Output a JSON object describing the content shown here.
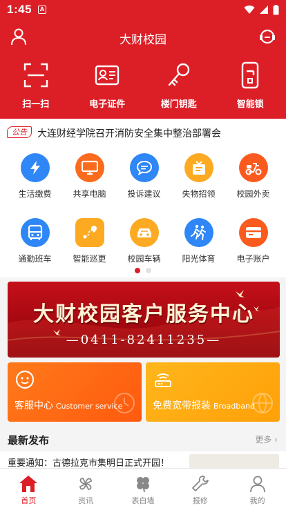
{
  "status": {
    "time": "1:45",
    "notif_glyph": "A"
  },
  "header": {
    "title": "大财校园"
  },
  "quick_actions": [
    {
      "label": "扫一扫",
      "icon": "scan-icon"
    },
    {
      "label": "电子证件",
      "icon": "id-card-icon"
    },
    {
      "label": "楼门钥匙",
      "icon": "key-icon"
    },
    {
      "label": "智能锁",
      "icon": "smart-lock-icon"
    }
  ],
  "notice": {
    "tag": "公告",
    "text": "大连财经学院召开消防安全集中整治部署会"
  },
  "services": [
    {
      "label": "生活缴费",
      "icon": "lightning-icon",
      "color": "#2f86f6"
    },
    {
      "label": "共享电脑",
      "icon": "monitor-icon",
      "color": "#fb6b1e"
    },
    {
      "label": "投诉建议",
      "icon": "chat-icon",
      "color": "#2f86f6"
    },
    {
      "label": "失物招领",
      "icon": "lost-found-icon",
      "color": "#fcaa22"
    },
    {
      "label": "校园外卖",
      "icon": "scooter-icon",
      "color": "#fb5a1e"
    },
    {
      "label": "通勤班车",
      "icon": "bus-icon",
      "color": "#2f86f6"
    },
    {
      "label": "智能巡更",
      "icon": "route-icon",
      "color": "#fcaa22"
    },
    {
      "label": "校园车辆",
      "icon": "car-icon",
      "color": "#fcaa22"
    },
    {
      "label": "阳光体育",
      "icon": "runner-icon",
      "color": "#2f86f6"
    },
    {
      "label": "电子账户",
      "icon": "wallet-card-icon",
      "color": "#fb5a1e"
    }
  ],
  "pager": {
    "active": 0,
    "count": 2,
    "active_color": "#dc1f27",
    "inactive_color": "#e2e2e2"
  },
  "banner": {
    "title": "大财校园客户服务中心",
    "phone": "—0411-82411235—"
  },
  "cards": {
    "customer": {
      "label": "客服中心",
      "sub": "Customer service"
    },
    "broadband": {
      "label": "免费宽带报装",
      "sub": "Broadband"
    }
  },
  "news": {
    "title": "最新发布",
    "more": "更多 ›",
    "item": "重要通知：古德拉克市集明日正式开园！"
  },
  "tabs": [
    {
      "label": "首页",
      "icon": "home-icon",
      "active": true
    },
    {
      "label": "资讯",
      "icon": "pinwheel-icon",
      "active": false
    },
    {
      "label": "表白墙",
      "icon": "clover-icon",
      "active": false
    },
    {
      "label": "报修",
      "icon": "wrench-icon",
      "active": false
    },
    {
      "label": "我的",
      "icon": "profile-icon",
      "active": false
    }
  ],
  "colors": {
    "brand_red": "#dc1f27",
    "tab_inactive": "#888888"
  }
}
